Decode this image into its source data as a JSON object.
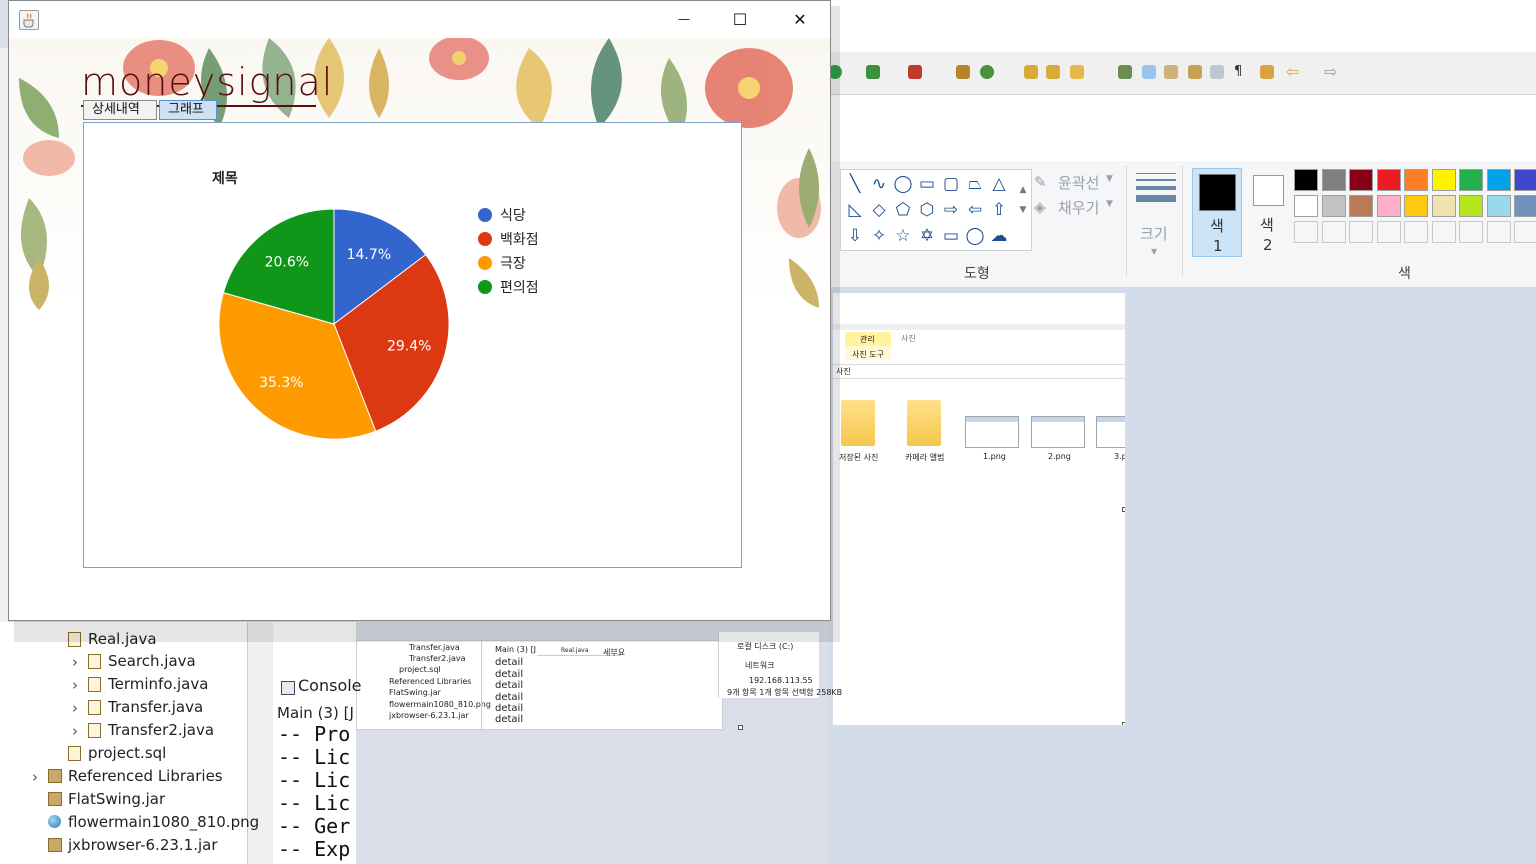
{
  "java_window": {
    "title": "",
    "controls": {
      "minimize": "—",
      "maximize": "☐",
      "close": "✕"
    },
    "logo_text": "moneysignal",
    "tabs": [
      {
        "label": "상세내역",
        "selected": false
      },
      {
        "label": "그래프",
        "selected": true
      }
    ]
  },
  "chart_data": {
    "type": "pie",
    "title": "제목",
    "categories": [
      "식당",
      "백화점",
      "극장",
      "편의점"
    ],
    "values": [
      14.7,
      29.4,
      35.3,
      20.6
    ],
    "value_labels": [
      "14.7%",
      "29.4%",
      "35.3%",
      "20.6%"
    ],
    "colors": [
      "#3366cc",
      "#dc3912",
      "#ff9900",
      "#109618"
    ],
    "legend_position": "right"
  },
  "paint": {
    "ribbon": {
      "outline_label": "윤곽선",
      "fill_label": "채우기",
      "size_label": "크기",
      "color1_label_a": "색",
      "color1_label_b": "1",
      "color2_label_a": "색",
      "color2_label_b": "2",
      "shapes_group": "도형",
      "colors_group": "색"
    },
    "palette": [
      "#000000",
      "#7f7f7f",
      "#880015",
      "#ed1c24",
      "#ff7f27",
      "#fff200",
      "#22b14c",
      "#00a2e8",
      "#3f48cc",
      "#ffffff",
      "#c3c3c3",
      "#b97a57",
      "#ffaec9",
      "#ffc90e",
      "#efe4b0",
      "#b5e61d",
      "#99d9ea",
      "#7092be"
    ],
    "color1": "#000000",
    "color2": "#ffffff",
    "canvas_screenshot": {
      "manage_tab": "관리",
      "photo_tab": "사진",
      "photo_tools": "사진 도구",
      "path": "사진",
      "items": [
        "저장된 사진",
        "카메라 앨범",
        "1.png",
        "2.png",
        "3.p"
      ],
      "drive": "로컬 디스크 (C:)",
      "network": "네트워크",
      "ip": "192.168.113.55",
      "status": "9개 항목     1개 항목 선택함 258KB",
      "mini_tree": [
        "Transfer.java",
        "Transfer2.java",
        "project.sql",
        "Referenced Libraries",
        "FlatSwing.jar",
        "flowermain1080_810.png",
        "jxbrowser-6.23.1.jar"
      ],
      "mini_console_head": "Main (3) [J",
      "mini_console_lines": [
        "detail",
        "detail",
        "detail",
        "detail",
        "detail",
        "detail"
      ],
      "mini_file": "Real.java",
      "mini_code": "세부요"
    }
  },
  "eclipse": {
    "tree": [
      {
        "label": "Real.java",
        "kind": "java",
        "arrow": true
      },
      {
        "label": "Search.java",
        "kind": "java",
        "arrow": true
      },
      {
        "label": "Terminfo.java",
        "kind": "java",
        "arrow": true
      },
      {
        "label": "Transfer.java",
        "kind": "java",
        "arrow": true
      },
      {
        "label": "Transfer2.java",
        "kind": "java",
        "arrow": true
      },
      {
        "label": "project.sql",
        "kind": "file",
        "arrow": false
      },
      {
        "label": "Referenced Libraries",
        "kind": "lib",
        "arrow": true
      },
      {
        "label": "FlatSwing.jar",
        "kind": "jar",
        "arrow": false
      },
      {
        "label": "flowermain1080_810.png",
        "kind": "png",
        "arrow": false
      },
      {
        "label": "jxbrowser-6.23.1.jar",
        "kind": "jar",
        "arrow": false
      }
    ],
    "console_tab": "Console",
    "console_head": "Main (3) [J",
    "console_lines": [
      "-- Pro",
      "-- Lic",
      "-- Lic",
      "-- Lic",
      "-- Ger",
      "-- Exp"
    ]
  }
}
